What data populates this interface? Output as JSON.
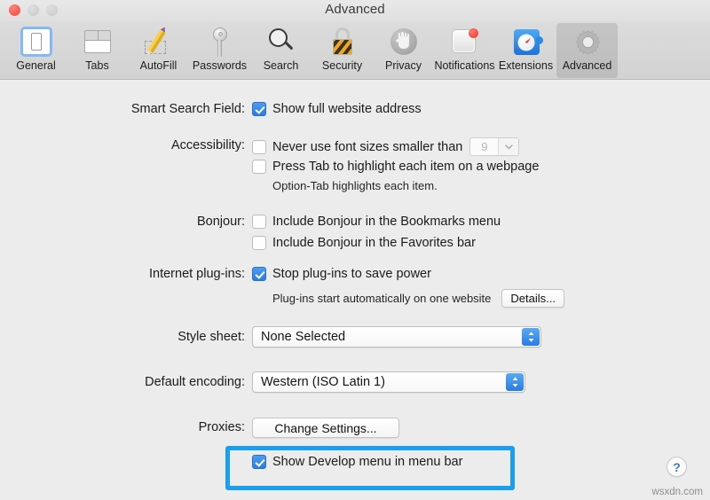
{
  "window": {
    "title": "Advanced",
    "traffic_lights": [
      "close",
      "minimize",
      "maximize"
    ]
  },
  "toolbar": {
    "items": [
      {
        "label": "General",
        "icon": "general-icon",
        "selected": false
      },
      {
        "label": "Tabs",
        "icon": "tabs-icon",
        "selected": false
      },
      {
        "label": "AutoFill",
        "icon": "autofill-pencil-icon",
        "selected": false
      },
      {
        "label": "Passwords",
        "icon": "key-icon",
        "selected": false
      },
      {
        "label": "Search",
        "icon": "magnifier-icon",
        "selected": false
      },
      {
        "label": "Security",
        "icon": "padlock-icon",
        "selected": false
      },
      {
        "label": "Privacy",
        "icon": "hand-icon",
        "selected": false
      },
      {
        "label": "Notifications",
        "icon": "notification-card-icon",
        "selected": false
      },
      {
        "label": "Extensions",
        "icon": "puzzle-compass-icon",
        "selected": false
      },
      {
        "label": "Advanced",
        "icon": "gear-icon",
        "selected": true
      }
    ]
  },
  "settings": {
    "smart_search_field": {
      "label": "Smart Search Field:",
      "checkbox_label": "Show full website address",
      "checked": true
    },
    "accessibility": {
      "label": "Accessibility:",
      "never_use_font_sizes": {
        "checkbox_label": "Never use font sizes smaller than",
        "checked": false,
        "font_size_value": "9",
        "font_size_disabled": true
      },
      "press_tab": {
        "checkbox_label": "Press Tab to highlight each item on a webpage",
        "checked": false
      },
      "hint": "Option-Tab highlights each item."
    },
    "bonjour": {
      "label": "Bonjour:",
      "options": [
        {
          "checkbox_label": "Include Bonjour in the Bookmarks menu",
          "checked": false
        },
        {
          "checkbox_label": "Include Bonjour in the Favorites bar",
          "checked": false
        }
      ]
    },
    "internet_plugins": {
      "label": "Internet plug-ins:",
      "checkbox_label": "Stop plug-ins to save power",
      "checked": true,
      "hint": "Plug-ins start automatically on one website",
      "details_button": "Details..."
    },
    "style_sheet": {
      "label": "Style sheet:",
      "value": "None Selected"
    },
    "default_encoding": {
      "label": "Default encoding:",
      "value": "Western (ISO Latin 1)"
    },
    "proxies": {
      "label": "Proxies:",
      "button": "Change Settings..."
    },
    "develop_menu": {
      "checkbox_label": "Show Develop menu in menu bar",
      "checked": true,
      "highlighted": true,
      "highlight_color": "#1a9ff0"
    }
  },
  "help_button": {
    "glyph": "?"
  },
  "watermark": {
    "text": "wsxdn.com"
  },
  "colors": {
    "accent_blue": "#2a7ce0",
    "highlight_blue": "#1a9ff0",
    "toolbar_bg": "#d6d6d6",
    "content_bg": "#ececec"
  }
}
